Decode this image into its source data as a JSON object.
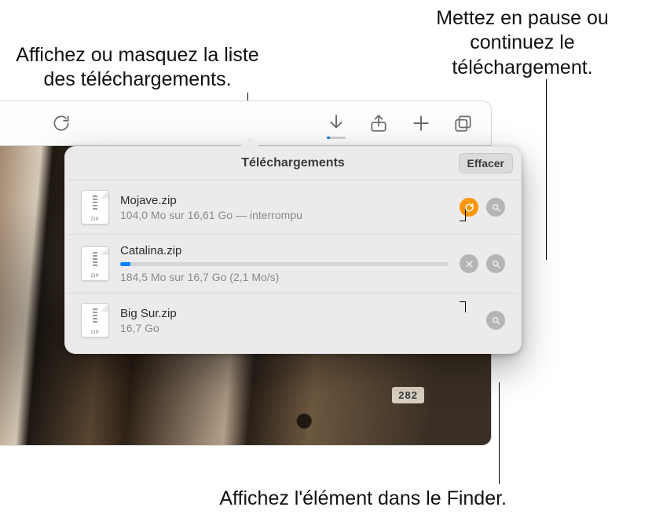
{
  "callouts": {
    "toggle_list": "Affichez ou masquez la liste des téléchargements.",
    "pause_resume": "Mettez en pause ou continuez le téléchargement.",
    "show_in_finder": "Affichez l'élément dans le Finder."
  },
  "toolbar": {
    "reload_icon_name": "reload-icon",
    "downloads_icon_name": "downloads-icon",
    "share_icon_name": "share-icon",
    "newtab_icon_name": "plus-icon",
    "tabs_icon_name": "tabs-overview-icon"
  },
  "background": {
    "house_number": "282"
  },
  "popover": {
    "title": "Téléchargements",
    "clear_label": "Effacer",
    "items": [
      {
        "name": "Mojave.zip",
        "meta": "104,0 Mo sur 16,61 Go — interrompu",
        "state": "paused",
        "actions": [
          "resume",
          "reveal"
        ]
      },
      {
        "name": "Catalina.zip",
        "meta": "184,5 Mo sur 16,7 Go (2,1 Mo/s)",
        "state": "downloading",
        "progress_pct": 3,
        "actions": [
          "stop",
          "reveal"
        ]
      },
      {
        "name": "Big Sur.zip",
        "meta": "16,7 Go",
        "state": "complete",
        "actions": [
          "reveal"
        ]
      }
    ]
  }
}
